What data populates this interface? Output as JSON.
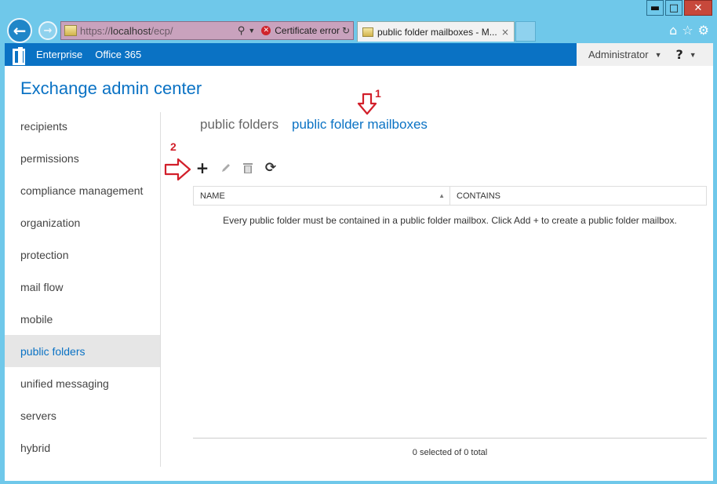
{
  "browser": {
    "window_controls": {
      "minimize": "▬",
      "maximize": "□",
      "close": "✕"
    },
    "back_icon": "arrow-left-icon",
    "forward_icon": "arrow-right-icon",
    "address": {
      "url_scheme": "https://",
      "url_host": "localhost",
      "url_path": "/ecp/",
      "cert_error": "Certificate error"
    },
    "tab": {
      "title": "public folder mailboxes - M...",
      "close": "×"
    },
    "tools": [
      "home-icon",
      "star-icon",
      "gear-icon"
    ]
  },
  "topbar": {
    "links": [
      "Enterprise",
      "Office 365"
    ],
    "admin": "Administrator",
    "help": "?"
  },
  "app_title": "Exchange admin center",
  "sidebar": {
    "items": [
      {
        "label": "recipients"
      },
      {
        "label": "permissions"
      },
      {
        "label": "compliance management"
      },
      {
        "label": "organization"
      },
      {
        "label": "protection"
      },
      {
        "label": "mail flow"
      },
      {
        "label": "mobile"
      },
      {
        "label": "public folders",
        "active": true
      },
      {
        "label": "unified messaging"
      },
      {
        "label": "servers"
      },
      {
        "label": "hybrid"
      }
    ]
  },
  "tabs": {
    "public_folders": "public folders",
    "public_folder_mailboxes": "public folder mailboxes"
  },
  "annotations": {
    "step1": "1",
    "step2": "2",
    "color": "#d21f2a"
  },
  "toolbar": {
    "add": "+",
    "edit": "edit-icon",
    "delete": "delete-icon",
    "refresh": "refresh-icon"
  },
  "grid": {
    "columns": [
      "NAME",
      "CONTAINS"
    ],
    "empty_message": "Every public folder must be contained in a public folder mailbox. Click Add + to create a public folder mailbox.",
    "status": "0 selected of 0 total"
  },
  "colors": {
    "accent": "#0a72c4",
    "chrome": "#6fc8ea",
    "error": "#d0242c"
  }
}
